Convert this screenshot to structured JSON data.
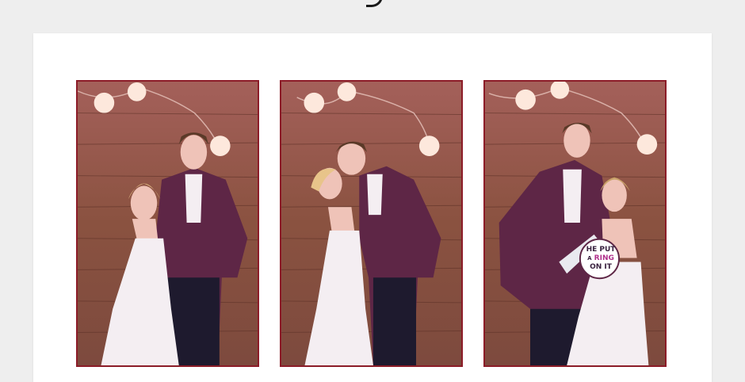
{
  "page": {
    "background": "#eeeeee"
  },
  "card": {
    "background": "#ffffff",
    "frame_color": "#8c1c28"
  },
  "photos": [
    {
      "description_name": "photo-couple-posing"
    },
    {
      "description_name": "photo-couple-kissing"
    },
    {
      "description_name": "photo-couple-with-sign"
    }
  ],
  "sign": {
    "line1": "HE PUT",
    "line2": "A",
    "line3": "RING",
    "line4": "ON IT"
  },
  "colors": {
    "wood": "#8a5240",
    "tux": "#5e2646",
    "dress": "#f4eef2",
    "skin": "#efc3b8",
    "bulb": "#fde8dc"
  }
}
